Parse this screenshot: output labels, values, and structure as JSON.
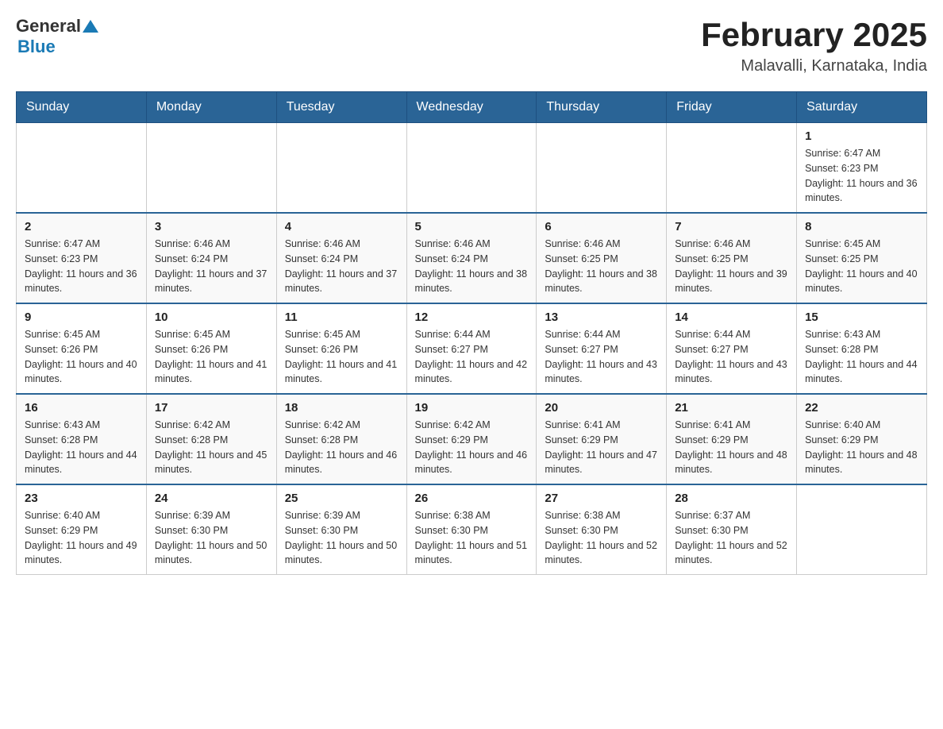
{
  "header": {
    "logo_general": "General",
    "logo_blue": "Blue",
    "title": "February 2025",
    "subtitle": "Malavalli, Karnataka, India"
  },
  "days_of_week": [
    "Sunday",
    "Monday",
    "Tuesday",
    "Wednesday",
    "Thursday",
    "Friday",
    "Saturday"
  ],
  "weeks": [
    {
      "days": [
        {
          "date": "",
          "info": ""
        },
        {
          "date": "",
          "info": ""
        },
        {
          "date": "",
          "info": ""
        },
        {
          "date": "",
          "info": ""
        },
        {
          "date": "",
          "info": ""
        },
        {
          "date": "",
          "info": ""
        },
        {
          "date": "1",
          "info": "Sunrise: 6:47 AM\nSunset: 6:23 PM\nDaylight: 11 hours and 36 minutes."
        }
      ]
    },
    {
      "days": [
        {
          "date": "2",
          "info": "Sunrise: 6:47 AM\nSunset: 6:23 PM\nDaylight: 11 hours and 36 minutes."
        },
        {
          "date": "3",
          "info": "Sunrise: 6:46 AM\nSunset: 6:24 PM\nDaylight: 11 hours and 37 minutes."
        },
        {
          "date": "4",
          "info": "Sunrise: 6:46 AM\nSunset: 6:24 PM\nDaylight: 11 hours and 37 minutes."
        },
        {
          "date": "5",
          "info": "Sunrise: 6:46 AM\nSunset: 6:24 PM\nDaylight: 11 hours and 38 minutes."
        },
        {
          "date": "6",
          "info": "Sunrise: 6:46 AM\nSunset: 6:25 PM\nDaylight: 11 hours and 38 minutes."
        },
        {
          "date": "7",
          "info": "Sunrise: 6:46 AM\nSunset: 6:25 PM\nDaylight: 11 hours and 39 minutes."
        },
        {
          "date": "8",
          "info": "Sunrise: 6:45 AM\nSunset: 6:25 PM\nDaylight: 11 hours and 40 minutes."
        }
      ]
    },
    {
      "days": [
        {
          "date": "9",
          "info": "Sunrise: 6:45 AM\nSunset: 6:26 PM\nDaylight: 11 hours and 40 minutes."
        },
        {
          "date": "10",
          "info": "Sunrise: 6:45 AM\nSunset: 6:26 PM\nDaylight: 11 hours and 41 minutes."
        },
        {
          "date": "11",
          "info": "Sunrise: 6:45 AM\nSunset: 6:26 PM\nDaylight: 11 hours and 41 minutes."
        },
        {
          "date": "12",
          "info": "Sunrise: 6:44 AM\nSunset: 6:27 PM\nDaylight: 11 hours and 42 minutes."
        },
        {
          "date": "13",
          "info": "Sunrise: 6:44 AM\nSunset: 6:27 PM\nDaylight: 11 hours and 43 minutes."
        },
        {
          "date": "14",
          "info": "Sunrise: 6:44 AM\nSunset: 6:27 PM\nDaylight: 11 hours and 43 minutes."
        },
        {
          "date": "15",
          "info": "Sunrise: 6:43 AM\nSunset: 6:28 PM\nDaylight: 11 hours and 44 minutes."
        }
      ]
    },
    {
      "days": [
        {
          "date": "16",
          "info": "Sunrise: 6:43 AM\nSunset: 6:28 PM\nDaylight: 11 hours and 44 minutes."
        },
        {
          "date": "17",
          "info": "Sunrise: 6:42 AM\nSunset: 6:28 PM\nDaylight: 11 hours and 45 minutes."
        },
        {
          "date": "18",
          "info": "Sunrise: 6:42 AM\nSunset: 6:28 PM\nDaylight: 11 hours and 46 minutes."
        },
        {
          "date": "19",
          "info": "Sunrise: 6:42 AM\nSunset: 6:29 PM\nDaylight: 11 hours and 46 minutes."
        },
        {
          "date": "20",
          "info": "Sunrise: 6:41 AM\nSunset: 6:29 PM\nDaylight: 11 hours and 47 minutes."
        },
        {
          "date": "21",
          "info": "Sunrise: 6:41 AM\nSunset: 6:29 PM\nDaylight: 11 hours and 48 minutes."
        },
        {
          "date": "22",
          "info": "Sunrise: 6:40 AM\nSunset: 6:29 PM\nDaylight: 11 hours and 48 minutes."
        }
      ]
    },
    {
      "days": [
        {
          "date": "23",
          "info": "Sunrise: 6:40 AM\nSunset: 6:29 PM\nDaylight: 11 hours and 49 minutes."
        },
        {
          "date": "24",
          "info": "Sunrise: 6:39 AM\nSunset: 6:30 PM\nDaylight: 11 hours and 50 minutes."
        },
        {
          "date": "25",
          "info": "Sunrise: 6:39 AM\nSunset: 6:30 PM\nDaylight: 11 hours and 50 minutes."
        },
        {
          "date": "26",
          "info": "Sunrise: 6:38 AM\nSunset: 6:30 PM\nDaylight: 11 hours and 51 minutes."
        },
        {
          "date": "27",
          "info": "Sunrise: 6:38 AM\nSunset: 6:30 PM\nDaylight: 11 hours and 52 minutes."
        },
        {
          "date": "28",
          "info": "Sunrise: 6:37 AM\nSunset: 6:30 PM\nDaylight: 11 hours and 52 minutes."
        },
        {
          "date": "",
          "info": ""
        }
      ]
    }
  ]
}
